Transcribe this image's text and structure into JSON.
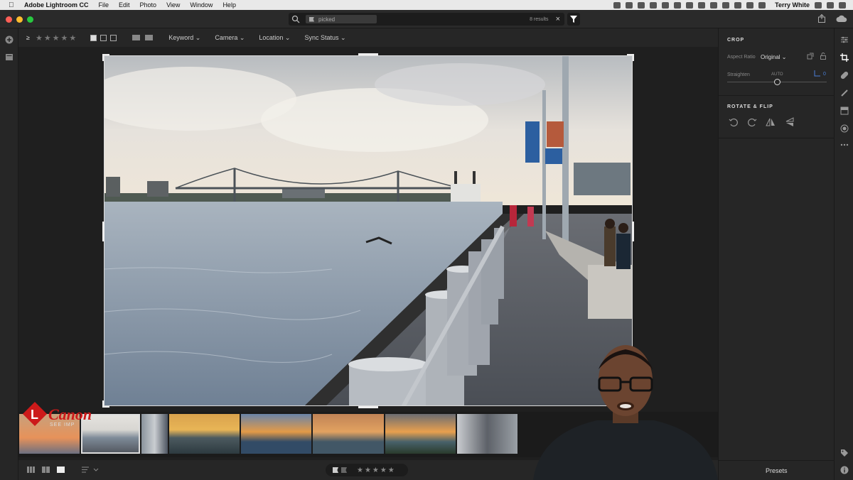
{
  "menubar": {
    "app_name": "Adobe Lightroom CC",
    "menus": [
      "File",
      "Edit",
      "Photo",
      "View",
      "Window",
      "Help"
    ],
    "user": "Terry White"
  },
  "search": {
    "chip_label": "picked",
    "results": "8 results"
  },
  "toolbar": {
    "rating_operator": "≥",
    "stars": "★★★★★",
    "filters": [
      "Keyword",
      "Camera",
      "Location",
      "Sync Status"
    ]
  },
  "panel": {
    "crop_title": "CROP",
    "aspect_ratio_label": "Aspect Ratio",
    "aspect_ratio_value": "Original",
    "straighten_label": "Straighten",
    "auto_label": "AUTO",
    "straighten_value": "0",
    "straighten_level": 0.5,
    "rotate_title": "ROTATE & FLIP",
    "presets_label": "Presets"
  },
  "bottombar": {
    "stars": "★★★★★"
  },
  "watermark": {
    "brand": "Canon",
    "tagline": "SEE IMP"
  },
  "icons": {
    "left_strip": [
      "add-photos-icon",
      "library-icon"
    ],
    "right_strip": [
      "sliders-icon",
      "crop-icon",
      "healing-icon",
      "brush-icon",
      "linear-gradient-icon",
      "radial-gradient-icon",
      "more-icon",
      "tag-icon",
      "info-icon"
    ],
    "titlebar_right": [
      "share-icon",
      "cloud-icon"
    ],
    "rotate_flip": [
      "rotate-left-icon",
      "rotate-right-icon",
      "flip-horizontal-icon",
      "flip-vertical-icon"
    ]
  },
  "colors": {
    "accent": "#cc1a1a",
    "panel_bg": "#262626",
    "canvas_bg": "#1f1f1f"
  }
}
